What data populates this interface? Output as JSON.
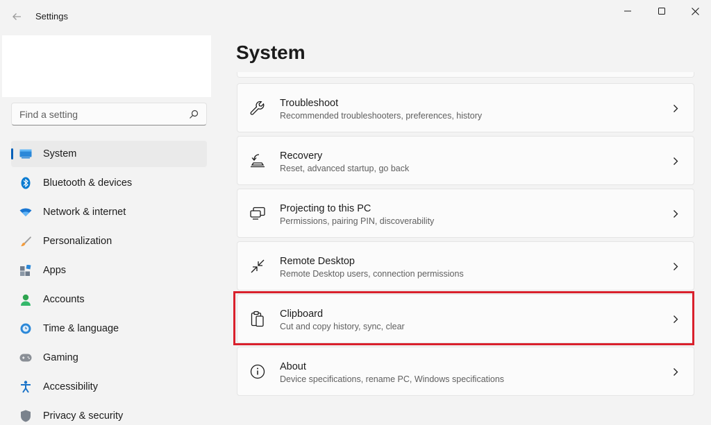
{
  "window": {
    "title": "Settings"
  },
  "search": {
    "placeholder": "Find a setting",
    "value": ""
  },
  "sidebar": {
    "items": [
      {
        "label": "System",
        "icon": "system-icon",
        "active": true
      },
      {
        "label": "Bluetooth & devices",
        "icon": "bluetooth-icon"
      },
      {
        "label": "Network & internet",
        "icon": "wifi-icon"
      },
      {
        "label": "Personalization",
        "icon": "brush-icon"
      },
      {
        "label": "Apps",
        "icon": "apps-icon"
      },
      {
        "label": "Accounts",
        "icon": "person-icon"
      },
      {
        "label": "Time & language",
        "icon": "globe-clock-icon"
      },
      {
        "label": "Gaming",
        "icon": "gamepad-icon"
      },
      {
        "label": "Accessibility",
        "icon": "accessibility-icon"
      },
      {
        "label": "Privacy & security",
        "icon": "shield-icon"
      }
    ]
  },
  "main": {
    "title": "System",
    "cards": [
      {
        "title": "Troubleshoot",
        "subtitle": "Recommended troubleshooters, preferences, history",
        "icon": "wrench-icon"
      },
      {
        "title": "Recovery",
        "subtitle": "Reset, advanced startup, go back",
        "icon": "recovery-icon"
      },
      {
        "title": "Projecting to this PC",
        "subtitle": "Permissions, pairing PIN, discoverability",
        "icon": "projector-icon"
      },
      {
        "title": "Remote Desktop",
        "subtitle": "Remote Desktop users, connection permissions",
        "icon": "remote-desktop-icon"
      },
      {
        "title": "Clipboard",
        "subtitle": "Cut and copy history, sync, clear",
        "icon": "clipboard-icon",
        "highlighted": true
      },
      {
        "title": "About",
        "subtitle": "Device specifications, rename PC, Windows specifications",
        "icon": "info-icon"
      }
    ]
  },
  "colors": {
    "accent": "#005fb8",
    "highlight": "#d9202c",
    "background": "#f3f3f3",
    "card": "#fbfbfb"
  }
}
